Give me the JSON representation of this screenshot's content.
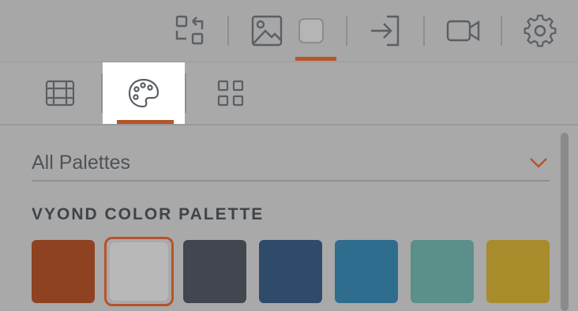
{
  "toolbar": {
    "buttons": [
      {
        "name": "swap-icon"
      },
      {
        "name": "image-icon"
      },
      {
        "name": "color-icon",
        "active": true
      },
      {
        "name": "enter-icon"
      },
      {
        "name": "video-camera-icon"
      },
      {
        "name": "gear-icon"
      }
    ],
    "accent_color": "#b6542a"
  },
  "subtabs": [
    {
      "name": "table-icon"
    },
    {
      "name": "palette-icon",
      "active": true
    },
    {
      "name": "grid-icon"
    }
  ],
  "palette_select": {
    "value": "All Palettes"
  },
  "section": {
    "title": "VYOND COLOR PALETTE"
  },
  "swatches": [
    {
      "color": "#8e4221"
    },
    {
      "color": "#b8b8b8",
      "selected": true
    },
    {
      "color": "#41464f"
    },
    {
      "color": "#2e4b69"
    },
    {
      "color": "#2e6d8e"
    },
    {
      "color": "#5a8f8a"
    },
    {
      "color": "#a88c2c"
    }
  ]
}
